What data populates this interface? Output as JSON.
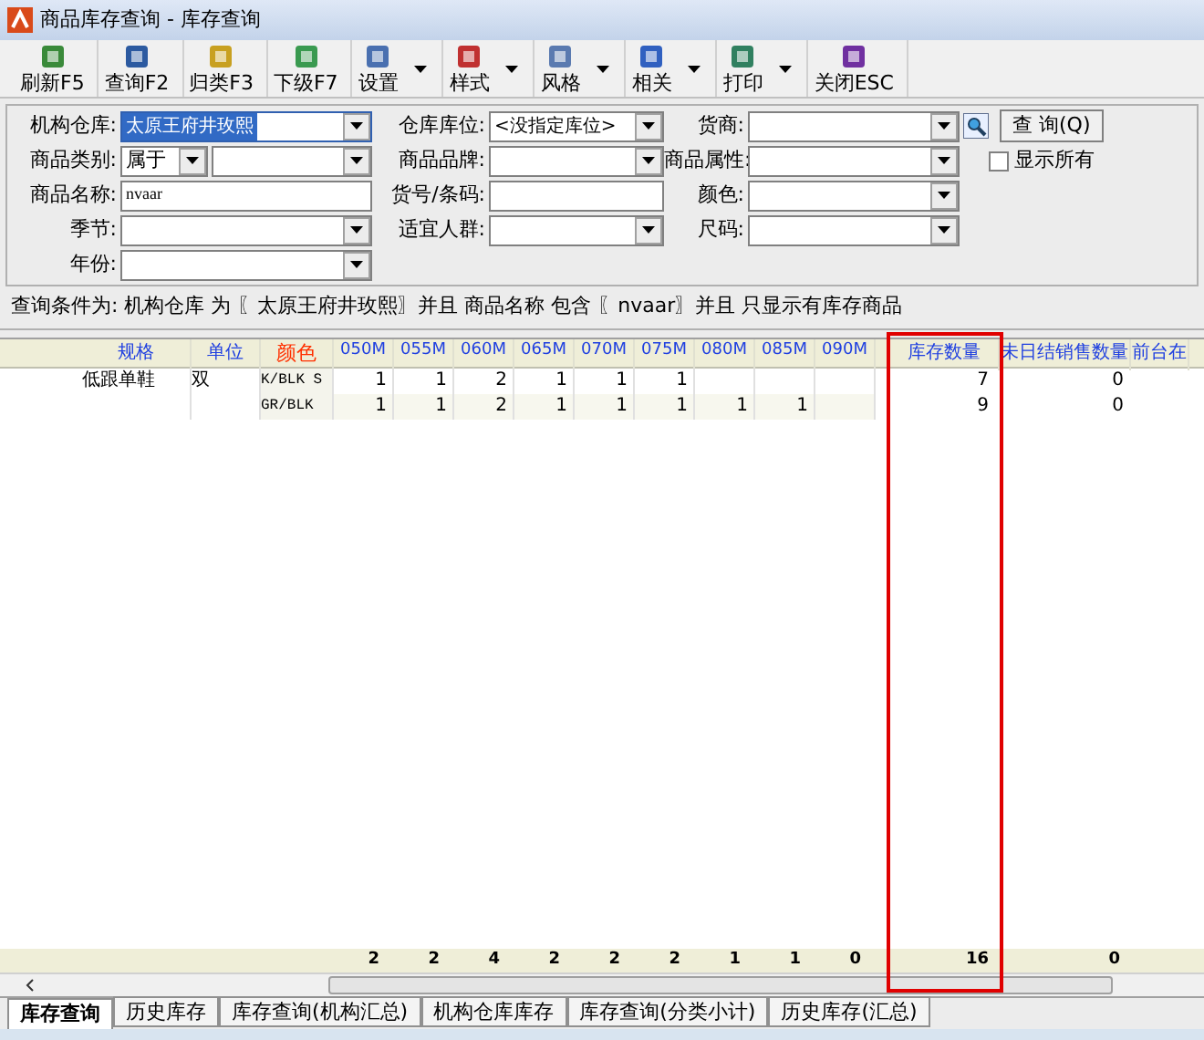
{
  "window": {
    "title": "商品库存查询 - 库存查询"
  },
  "toolbar": [
    {
      "label": "刷新F5",
      "has_menu": false
    },
    {
      "label": "查询F2",
      "has_menu": false
    },
    {
      "label": "归类F3",
      "has_menu": false
    },
    {
      "label": "下级F7",
      "has_menu": false
    },
    {
      "label": "设置",
      "has_menu": true
    },
    {
      "label": "样式",
      "has_menu": true
    },
    {
      "label": "风格",
      "has_menu": true
    },
    {
      "label": "相关",
      "has_menu": true
    },
    {
      "label": "打印",
      "has_menu": true
    },
    {
      "label": "关闭ESC",
      "has_menu": false
    }
  ],
  "form": {
    "rows": [
      [
        {
          "label": "机构仓库:",
          "kind": "combo",
          "value": "太原王府井玫熙",
          "selected": true
        },
        {
          "label": "仓库库位:",
          "kind": "combo",
          "value": "<没指定库位>",
          "selected": false
        },
        {
          "label": "货商:",
          "kind": "combo",
          "selected": false
        }
      ],
      [
        {
          "label": "商品类别:",
          "kind": "split",
          "value": "属于",
          "selected": false
        },
        {
          "label": "商品品牌:",
          "kind": "combo",
          "selected": false
        },
        {
          "label": "商品属性:",
          "kind": "combo",
          "selected": false
        }
      ],
      [
        {
          "label": "商品名称:",
          "kind": "text",
          "value": "nvaar",
          "selected": false
        },
        {
          "label": "货号/条码:",
          "kind": "text",
          "selected": false
        },
        {
          "label": "颜色:",
          "kind": "combo",
          "selected": false
        }
      ],
      [
        {
          "label": "季节:",
          "kind": "combo",
          "selected": false
        },
        {
          "label": "适宜人群:",
          "kind": "combo",
          "selected": false
        },
        {
          "label": "尺码:",
          "kind": "combo",
          "selected": false
        }
      ],
      [
        {
          "label": "年份:",
          "kind": "combo",
          "selected": false
        }
      ]
    ],
    "query_button": "查 询(Q)",
    "show_all": {
      "label": "显示所有",
      "checked": false
    }
  },
  "query_conditions": "查询条件为:  机构仓库 为 〖太原王府井玫熙〗并且 商品名称 包含 〖nvaar〗并且 只显示有库存商品",
  "table": {
    "columns": [
      "规格",
      "单位",
      "颜色",
      "050M",
      "055M",
      "060M",
      "065M",
      "070M",
      "075M",
      "080M",
      "085M",
      "090M",
      "库存数量",
      "未日结销售数量",
      "前台在"
    ],
    "rows": [
      {
        "spec": "低跟单鞋",
        "unit": "双",
        "variant": "K/BLK S",
        "sizes": [
          "1",
          "1",
          "2",
          "1",
          "1",
          "1"
        ],
        "stock": "7",
        "unsettled": "0"
      },
      {
        "variant": "GR/BLK",
        "sizes": [
          "1",
          "1",
          "2",
          "1",
          "1",
          "1",
          "1",
          "1"
        ],
        "stock": "9",
        "unsettled": "0"
      }
    ],
    "totals": {
      "sizes": [
        "2",
        "2",
        "4",
        "2",
        "2",
        "2",
        "1",
        "1",
        "0"
      ],
      "stock": "16",
      "unsettled": "0"
    }
  },
  "tabs": [
    {
      "label": "库存查询",
      "selected": true
    },
    {
      "label": "历史库存",
      "selected": false
    },
    {
      "label": "库存查询(机构汇总)",
      "selected": false
    },
    {
      "label": "机构仓库库存",
      "selected": false
    },
    {
      "label": "库存查询(分类小计)",
      "selected": false
    },
    {
      "label": "历史库存(汇总)",
      "selected": false
    }
  ]
}
